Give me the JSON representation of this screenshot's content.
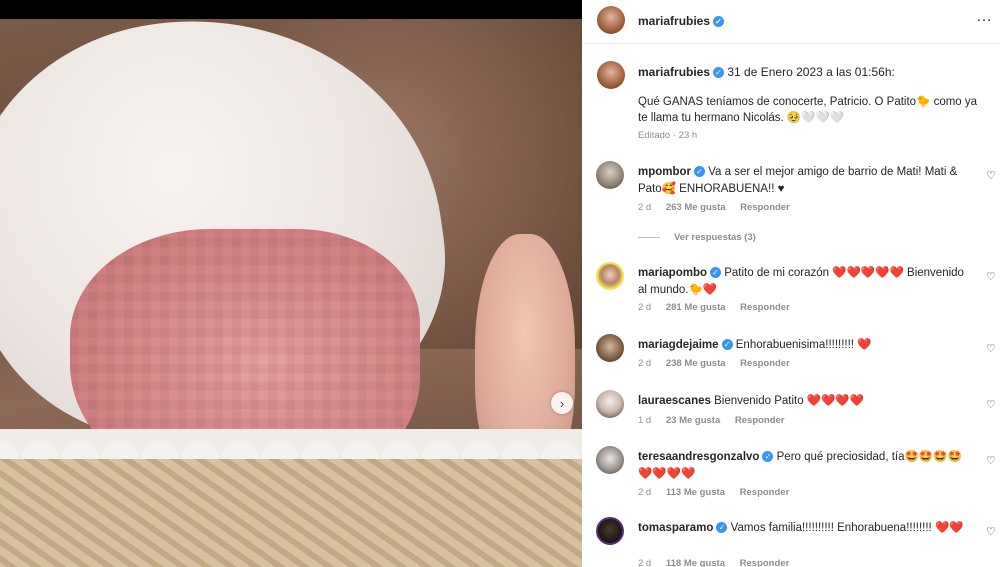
{
  "post": {
    "username": "mariafrubies",
    "date": "31 de Enero 2023 a las 01:56h:",
    "caption": "Qué GANAS teníamos de conocerte, Patricio. O Patito🐤 como ya te llama tu hermano Nicolás. 🥹🤍🤍🤍",
    "edited": "Editado · 23 h",
    "verified_badge": "✓",
    "more_icon": "…"
  },
  "comments": [
    {
      "username": "mpombor",
      "text": "Va a ser el mejor amigo de barrio de Mati! Mati & Pato🥰 ENHORABUENA!! ♥",
      "age": "2 d",
      "likes": "263 Me gusta",
      "reply": "Responder",
      "view_replies": "Ver respuestas (3)"
    },
    {
      "username": "mariapombo",
      "text": "Patito de mi corazón ❤️❤️❤️❤️❤️ Bienvenido al mundo.🐤❤️",
      "age": "2 d",
      "likes": "281 Me gusta",
      "reply": "Responder"
    },
    {
      "username": "mariagdejaime",
      "text": "Enhorabuenisima!!!!!!!!! ❤️",
      "age": "2 d",
      "likes": "238 Me gusta",
      "reply": "Responder"
    },
    {
      "username": "lauraescanes",
      "text": "Bienvenido Patito ❤️❤️❤️❤️",
      "age": "1 d",
      "likes": "23 Me gusta",
      "reply": "Responder"
    },
    {
      "username": "teresaandresgonzalvo",
      "text": "Pero qué preciosidad, tía🤩🤩🤩🤩 ❤️❤️❤️❤️",
      "age": "2 d",
      "likes": "113 Me gusta",
      "reply": "Responder"
    },
    {
      "username": "tomasparamo",
      "text": "Vamos familia!!!!!!!!!! Enhorabuena!!!!!!!! ❤️❤️",
      "age": "2 d",
      "likes": "118 Me gusta",
      "reply": "Responder"
    }
  ],
  "ui": {
    "next_icon": "›",
    "heart_icon": "♡"
  }
}
